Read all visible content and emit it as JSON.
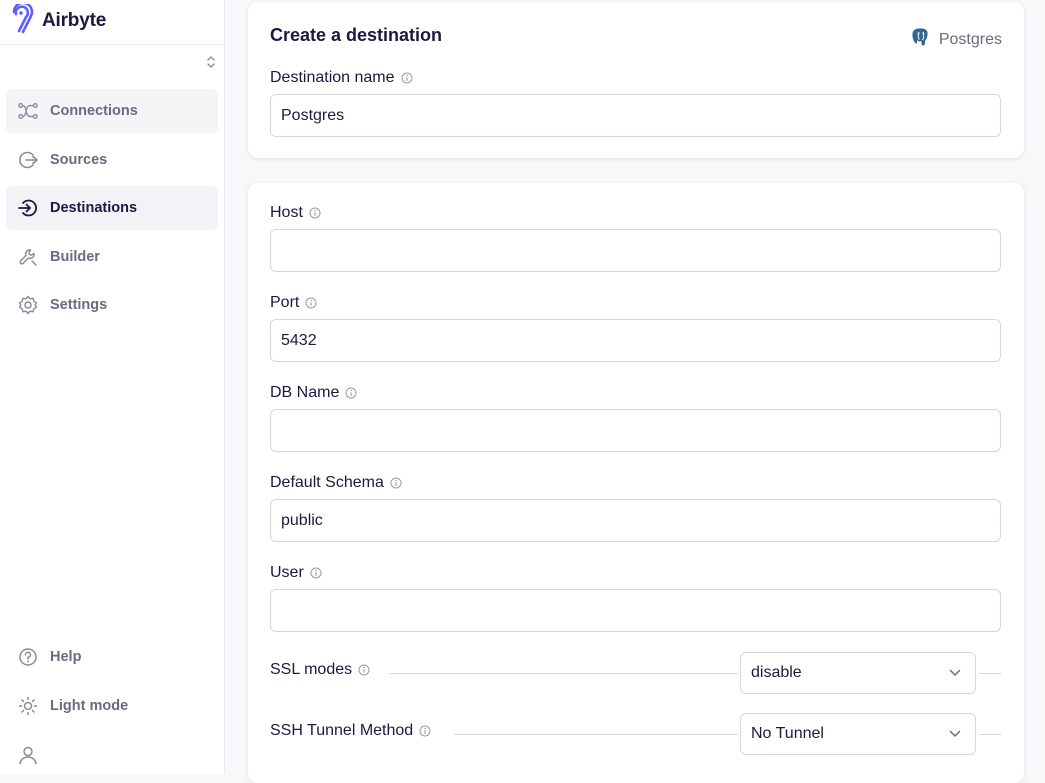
{
  "brand": {
    "name": "Airbyte",
    "logo_icon": "airbyte-logo-icon"
  },
  "sidebar": {
    "items": [
      {
        "label": "Connections",
        "icon": "connections-icon"
      },
      {
        "label": "Sources",
        "icon": "sources-icon"
      },
      {
        "label": "Destinations",
        "icon": "destinations-icon",
        "active": true
      },
      {
        "label": "Builder",
        "icon": "builder-icon"
      },
      {
        "label": "Settings",
        "icon": "settings-icon"
      }
    ],
    "bottom": [
      {
        "label": "Help",
        "icon": "help-icon"
      },
      {
        "label": "Light mode",
        "icon": "sun-icon"
      }
    ]
  },
  "create_card": {
    "title": "Create a destination",
    "connector_name": "Postgres",
    "destination_name": {
      "label": "Destination name",
      "value": "Postgres"
    }
  },
  "config": {
    "host": {
      "label": "Host",
      "value": ""
    },
    "port": {
      "label": "Port",
      "value": "5432"
    },
    "db_name": {
      "label": "DB Name",
      "value": ""
    },
    "default_schema": {
      "label": "Default Schema",
      "value": "public"
    },
    "user": {
      "label": "User",
      "value": ""
    },
    "ssl_modes": {
      "label": "SSL modes",
      "value": "disable"
    },
    "ssh_tunnel": {
      "label": "SSH Tunnel Method",
      "value": "No Tunnel"
    }
  },
  "colors": {
    "text": "#1a1a40",
    "muted": "#6a6a80",
    "accent": "#615eff",
    "border": "#d6d6de"
  }
}
